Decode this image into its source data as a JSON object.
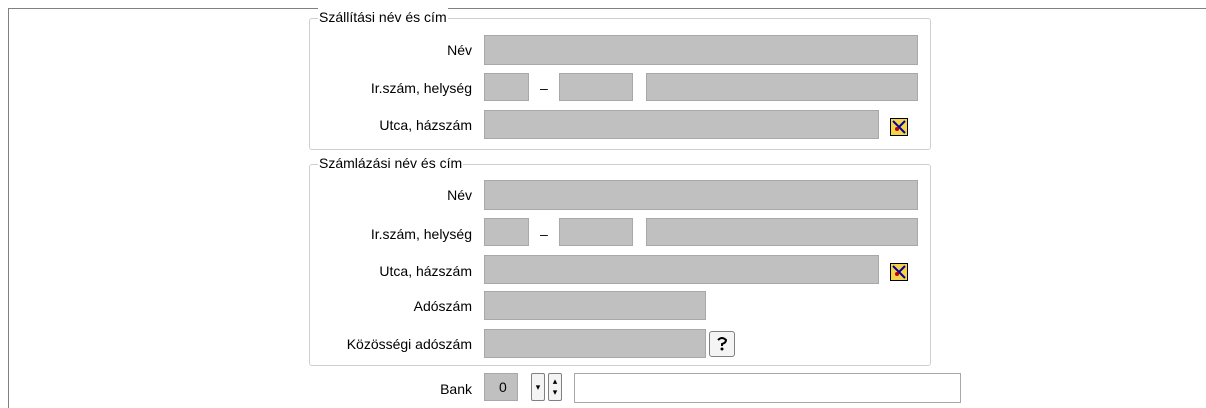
{
  "shipping": {
    "legend": "Szállítási név és cím",
    "name_label": "Név",
    "zip_label": "Ir.szám, helység",
    "street_label": "Utca, házszám",
    "dash": "–",
    "name_value": "",
    "zip1_value": "",
    "zip2_value": "",
    "city_value": "",
    "street_value": ""
  },
  "billing": {
    "legend": "Számlázási név és cím",
    "name_label": "Név",
    "zip_label": "Ir.szám, helység",
    "street_label": "Utca, házszám",
    "tax_label": "Adószám",
    "eu_tax_label": "Közösségi adószám",
    "dash": "–",
    "name_value": "",
    "zip1_value": "",
    "zip2_value": "",
    "city_value": "",
    "street_value": "",
    "tax_value": "",
    "eu_tax_value": ""
  },
  "bank": {
    "label": "Bank",
    "number": "0",
    "name_value": ""
  },
  "icons": {
    "map_pin": "map-pin-icon",
    "help": "help-icon",
    "dropdown": "dropdown-arrow-icon",
    "spinner": "spinner-icon"
  }
}
